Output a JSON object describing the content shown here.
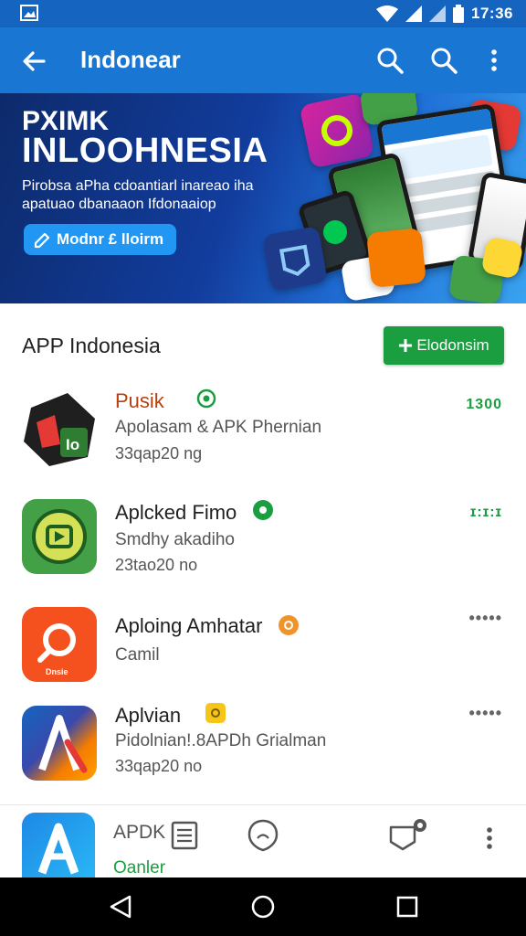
{
  "status": {
    "time": "17:36"
  },
  "appbar": {
    "title": "Indonear"
  },
  "banner": {
    "title_line1": "PXIMK",
    "title_line2": "INLOOHNESIA",
    "subtitle_line1": "Pirobsa aPha cdoantiarl inareao iha",
    "subtitle_line2": "apatuao dbanaaon Ifdonaaiop",
    "cta_label": "Modnr £ lloirm"
  },
  "section": {
    "title": "APP Indonesia",
    "add_label": "Elodonsim"
  },
  "apps": [
    {
      "name": "Pusik",
      "line2": "Apolasam & APK Phernian",
      "line3": "33qap20 ng",
      "meta": "1300",
      "name_color": "#b7410e",
      "badge_color": "#1a9e3f"
    },
    {
      "name": "Aplcked Fimo",
      "line2": "Smdhy akadiho",
      "line3": "23tao20 no",
      "meta": "ɪ:ɪ:ɪ",
      "name_color": "#212121",
      "badge_color": "#1a9e3f"
    },
    {
      "name": "Aploing Amhatar",
      "line2": "Camil",
      "line3": "",
      "meta": "•••••",
      "name_color": "#212121",
      "badge_color": "#f0932b"
    },
    {
      "name": "Aplvian",
      "line2": "Pidolnian!.8APDh Grialman",
      "line3": "33qap20 no",
      "meta": "•••••",
      "name_color": "#212121",
      "badge_color": "#f5c518"
    }
  ],
  "bottom": {
    "app_label": "APDK",
    "owner_label": "Oanler"
  },
  "colors": {
    "primary": "#1976d2",
    "status": "#1565c0",
    "accent_green": "#1a9e3f"
  }
}
